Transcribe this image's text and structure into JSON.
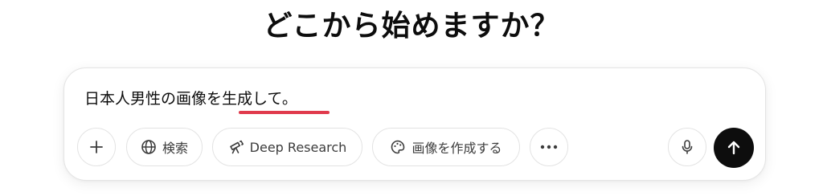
{
  "heading": "どこから始めますか？",
  "composer": {
    "prompt_text": "日本人男性の画像を生成して。"
  },
  "toolbar": {
    "add_icon": "plus-icon",
    "search_label": "検索",
    "search_icon": "globe-icon",
    "deep_research_label": "Deep Research",
    "deep_research_icon": "telescope-icon",
    "create_image_label": "画像を作成する",
    "create_image_icon": "palette-icon",
    "more_icon": "more-horizontal-icon",
    "mic_icon": "microphone-icon",
    "send_icon": "arrow-up-icon"
  },
  "colors": {
    "send_button_bg": "#0d0d0d",
    "spellcheck_underline": "#e03a4c",
    "border": "#e3e3e3"
  }
}
